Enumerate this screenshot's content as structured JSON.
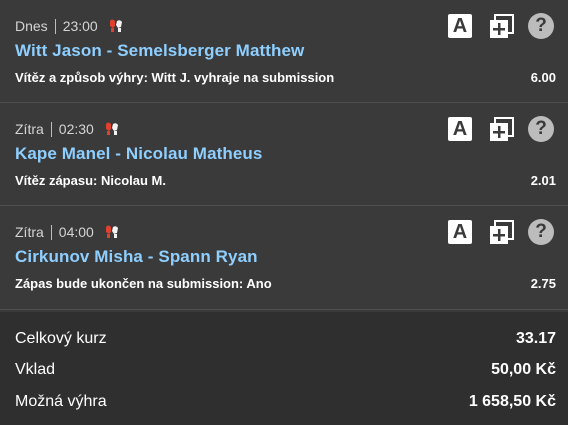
{
  "bets": [
    {
      "day": "Dnes",
      "time": "23:00",
      "sport_icon": "mma-gloves-icon",
      "match": "Witt Jason - Semelsberger Matthew",
      "market": "Vítěz a způsob výhry: Witt J. vyhraje na submission",
      "odds": "6.00",
      "icon_a_label": "A"
    },
    {
      "day": "Zítra",
      "time": "02:30",
      "sport_icon": "mma-gloves-icon",
      "match": "Kape Manel - Nicolau Matheus",
      "market": "Vítěz zápasu: Nicolau M.",
      "odds": "2.01",
      "icon_a_label": "A"
    },
    {
      "day": "Zítra",
      "time": "04:00",
      "sport_icon": "mma-gloves-icon",
      "match": "Cirkunov Misha - Spann Ryan",
      "market": "Zápas bude ukončen na submission: Ano",
      "odds": "2.75",
      "icon_a_label": "A"
    }
  ],
  "help_glyph": "?",
  "summary": {
    "total_odds_label": "Celkový kurz",
    "total_odds_value": "33.17",
    "stake_label": "Vklad",
    "stake_value": "50,00 Kč",
    "win_label": "Možná výhra",
    "win_value": "1 658,50 Kč"
  },
  "colors": {
    "background": "#3a3a3a",
    "summary_background": "#2f2f2f",
    "match_link": "#8ecfff",
    "glove_red": "#e0402e"
  }
}
